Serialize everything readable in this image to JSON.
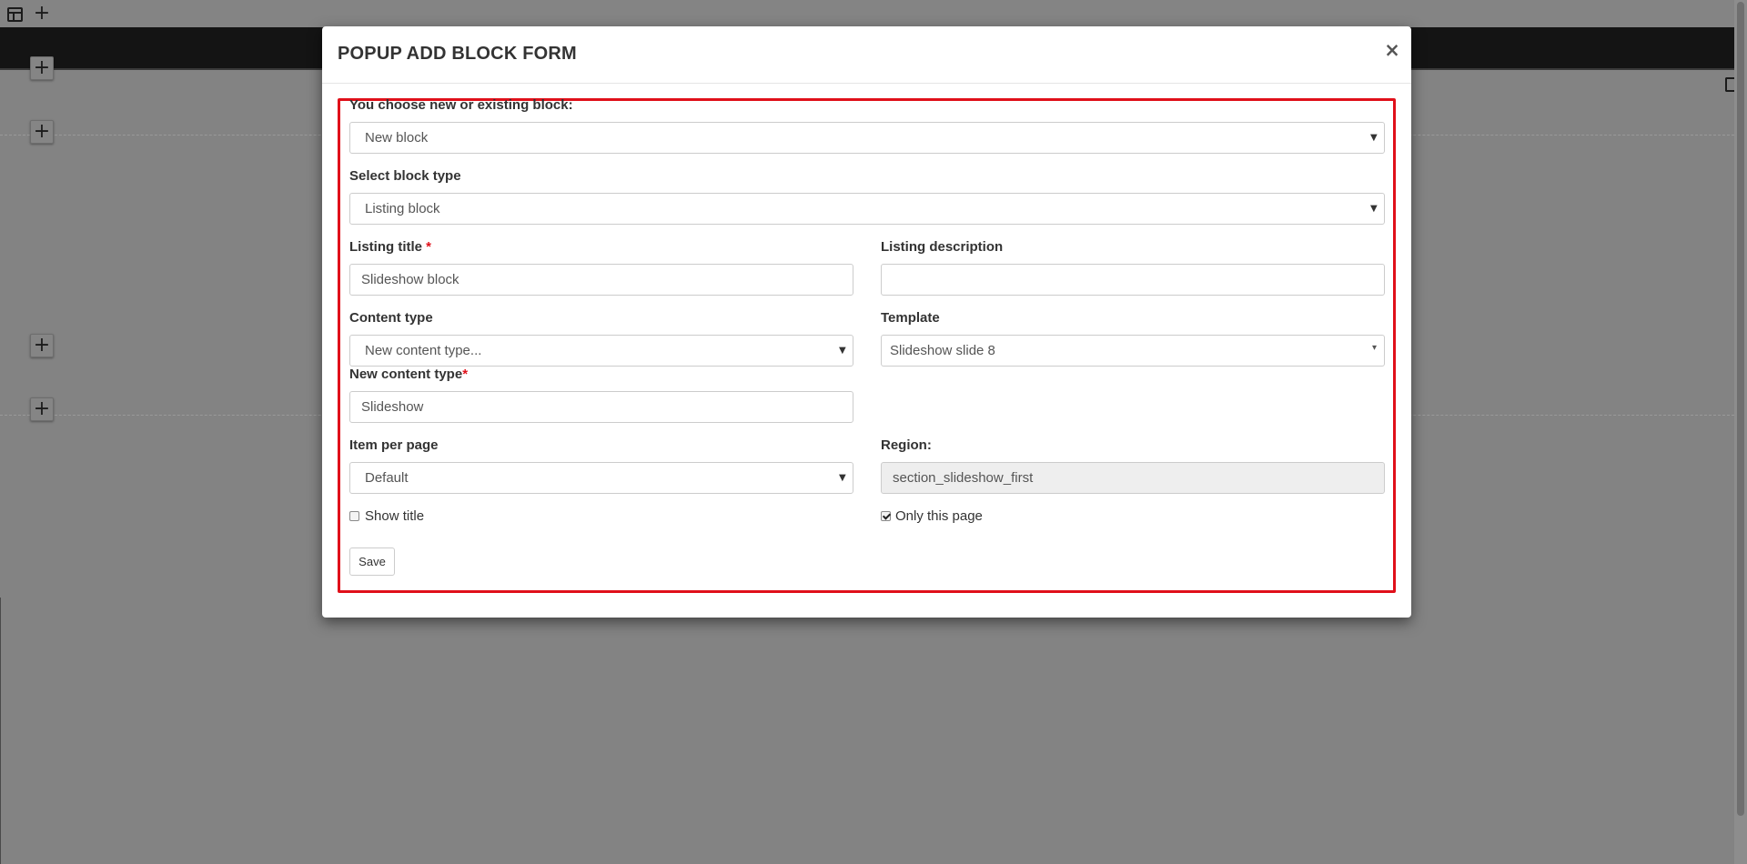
{
  "background": {
    "add_button_label": "+"
  },
  "modal": {
    "title": "POPUP ADD BLOCK FORM",
    "close_label": "×",
    "form": {
      "block_choice": {
        "label": "You choose new or existing block:",
        "value": "New block"
      },
      "block_type": {
        "label": "Select block type",
        "value": "Listing block"
      },
      "listing_title": {
        "label": "Listing title",
        "required_mark": "*",
        "value": "Slideshow block"
      },
      "listing_description": {
        "label": "Listing description",
        "value": ""
      },
      "content_type": {
        "label": "Content type",
        "value": "New content type..."
      },
      "template": {
        "label": "Template",
        "value": "Slideshow slide 8"
      },
      "new_content_type": {
        "label": "New content type",
        "required_mark": "*",
        "value": "Slideshow"
      },
      "item_per_page": {
        "label": "Item per page",
        "value": "Default"
      },
      "region": {
        "label": "Region:",
        "value": "section_slideshow_first"
      },
      "show_title": {
        "label": "Show title",
        "checked": false
      },
      "only_this_page": {
        "label": "Only this page",
        "checked": true
      },
      "save_label": "Save"
    }
  },
  "colors": {
    "overlay": "#838383",
    "highlight_border": "#e0101a",
    "required": "#e0101a"
  },
  "icons": {
    "layout": "layout-table-icon",
    "add": "plus-icon",
    "close": "close-icon",
    "dropdown": "caret-down-icon"
  }
}
